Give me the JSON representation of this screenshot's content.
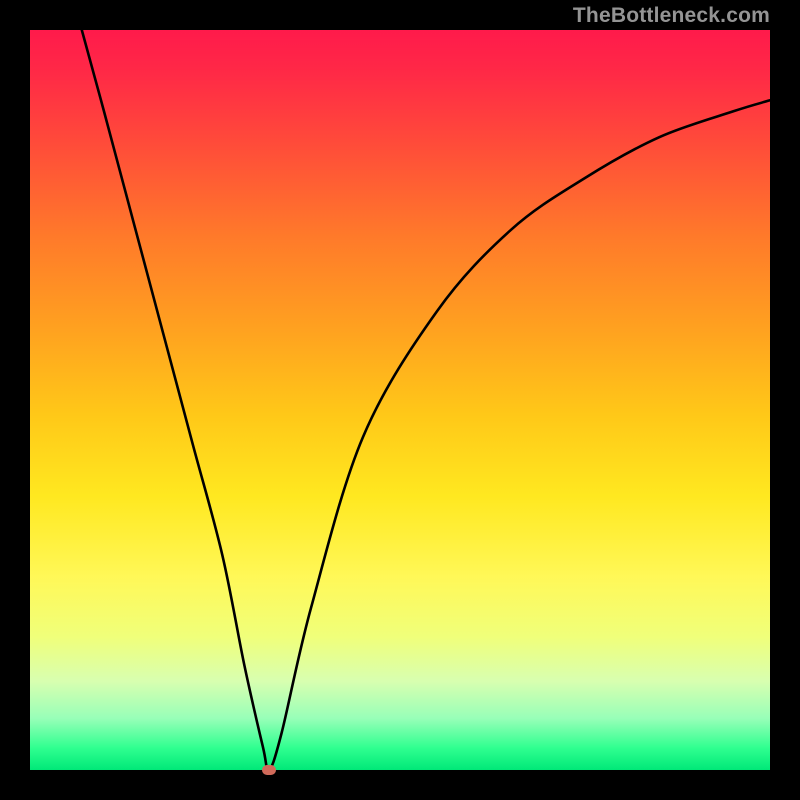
{
  "watermark": "TheBottleneck.com",
  "chart_data": {
    "type": "line",
    "title": "",
    "xlabel": "",
    "ylabel": "",
    "xlim": [
      0,
      100
    ],
    "ylim": [
      0,
      100
    ],
    "grid": false,
    "legend": false,
    "series": [
      {
        "name": "curve",
        "x": [
          7,
          10,
          14,
          18,
          22,
          26,
          29,
          31.5,
          32.3,
          34,
          38,
          45,
          55,
          65,
          75,
          85,
          95,
          100
        ],
        "y": [
          100,
          89,
          74,
          59,
          44,
          29,
          14,
          3,
          0,
          5,
          22,
          45,
          62,
          73,
          80,
          85.5,
          89,
          90.5
        ]
      }
    ],
    "marker_point": {
      "x": 32.3,
      "y": 0
    },
    "gradient_stops": [
      {
        "pos": 0,
        "color": "#ff1a4b"
      },
      {
        "pos": 50,
        "color": "#ffd020"
      },
      {
        "pos": 80,
        "color": "#f8ff70"
      },
      {
        "pos": 100,
        "color": "#00e878"
      }
    ]
  }
}
